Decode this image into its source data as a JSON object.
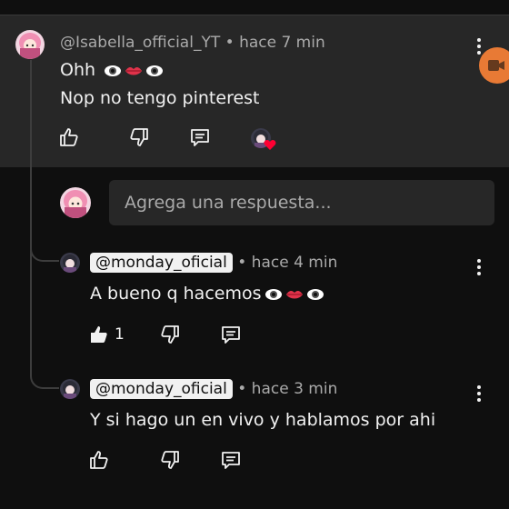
{
  "comment": {
    "author": "@Isabella_official_YT",
    "time": "hace 7 min",
    "separator": "•",
    "line1": "Ohh",
    "line2": "Nop no tengo pinterest"
  },
  "reply_input": {
    "placeholder": "Agrega una respuesta..."
  },
  "replies": [
    {
      "author": "@monday_oficial",
      "time": "hace 4 min",
      "text": "A bueno q hacemos",
      "likes": "1"
    },
    {
      "author": "@monday_oficial",
      "time": "hace 3 min",
      "text": "Y si hago un en vivo y hablamos por ahi",
      "likes": ""
    }
  ],
  "colors": {
    "background": "#0f0f0f",
    "highlight": "#272727",
    "heart": "#ff0033",
    "side_button": "#e87a35"
  },
  "icons": [
    "like-icon",
    "dislike-icon",
    "reply-icon",
    "heart-icon",
    "kebab-menu-icon",
    "eye-emoji",
    "lips-emoji"
  ]
}
